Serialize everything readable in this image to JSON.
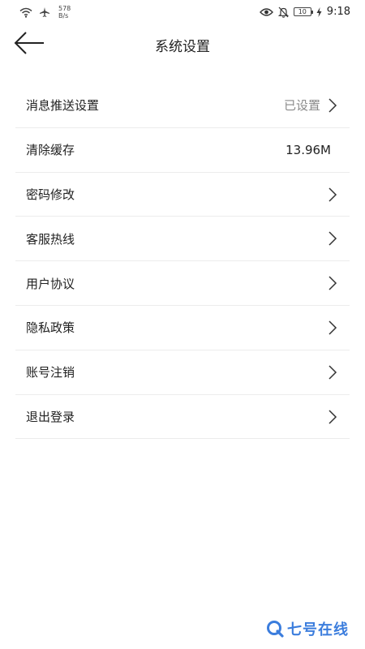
{
  "status_bar": {
    "net_speed_value": "578",
    "net_speed_unit": "B/s",
    "battery": "10",
    "time": "9:18"
  },
  "header": {
    "title": "系统设置"
  },
  "settings": [
    {
      "label": "消息推送设置",
      "value": "已设置",
      "chevron": true
    },
    {
      "label": "清除缓存",
      "value": "13.96M",
      "chevron": false
    },
    {
      "label": "密码修改",
      "value": "",
      "chevron": true
    },
    {
      "label": "客服热线",
      "value": "",
      "chevron": true
    },
    {
      "label": "用户协议",
      "value": "",
      "chevron": true
    },
    {
      "label": "隐私政策",
      "value": "",
      "chevron": true
    },
    {
      "label": "账号注销",
      "value": "",
      "chevron": true
    },
    {
      "label": "退出登录",
      "value": "",
      "chevron": true
    }
  ],
  "watermark": {
    "text": "七号在线",
    "color": "#3b7ddd"
  }
}
